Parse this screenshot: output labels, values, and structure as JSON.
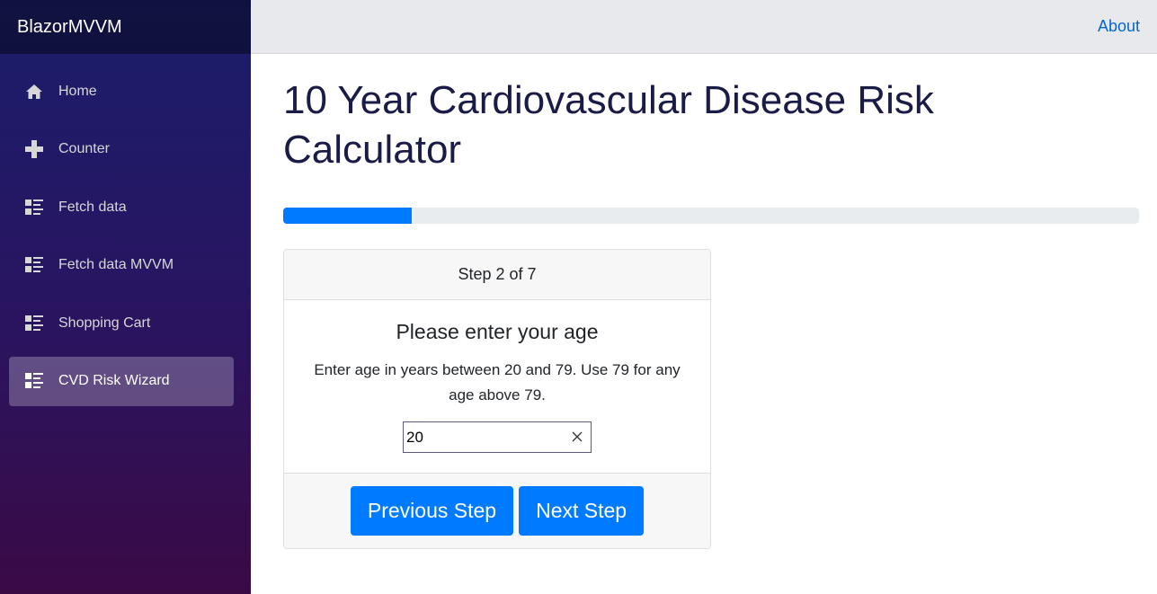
{
  "app": {
    "brand": "BlazorMVVM"
  },
  "topbar": {
    "about": "About"
  },
  "sidebar": {
    "items": [
      {
        "label": "Home",
        "icon": "home-icon",
        "active": false
      },
      {
        "label": "Counter",
        "icon": "plus-icon",
        "active": false
      },
      {
        "label": "Fetch data",
        "icon": "list-rich-icon",
        "active": false
      },
      {
        "label": "Fetch data MVVM",
        "icon": "list-rich-icon",
        "active": false
      },
      {
        "label": "Shopping Cart",
        "icon": "list-rich-icon",
        "active": false
      },
      {
        "label": "CVD Risk Wizard",
        "icon": "list-rich-icon",
        "active": true
      }
    ]
  },
  "main": {
    "title": "10 Year Cardiovascular Disease Risk Calculator",
    "progress_fraction": 0.15,
    "wizard": {
      "step_label": "Step 2 of 7",
      "question": "Please enter your age",
      "description": "Enter age in years between 20 and 79. Use 79 for any age above 79.",
      "age_value": "20",
      "previous_label": "Previous Step",
      "next_label": "Next Step"
    }
  },
  "colors": {
    "accent": "#007bff",
    "link": "#0366d6",
    "title": "#1a1b46"
  }
}
